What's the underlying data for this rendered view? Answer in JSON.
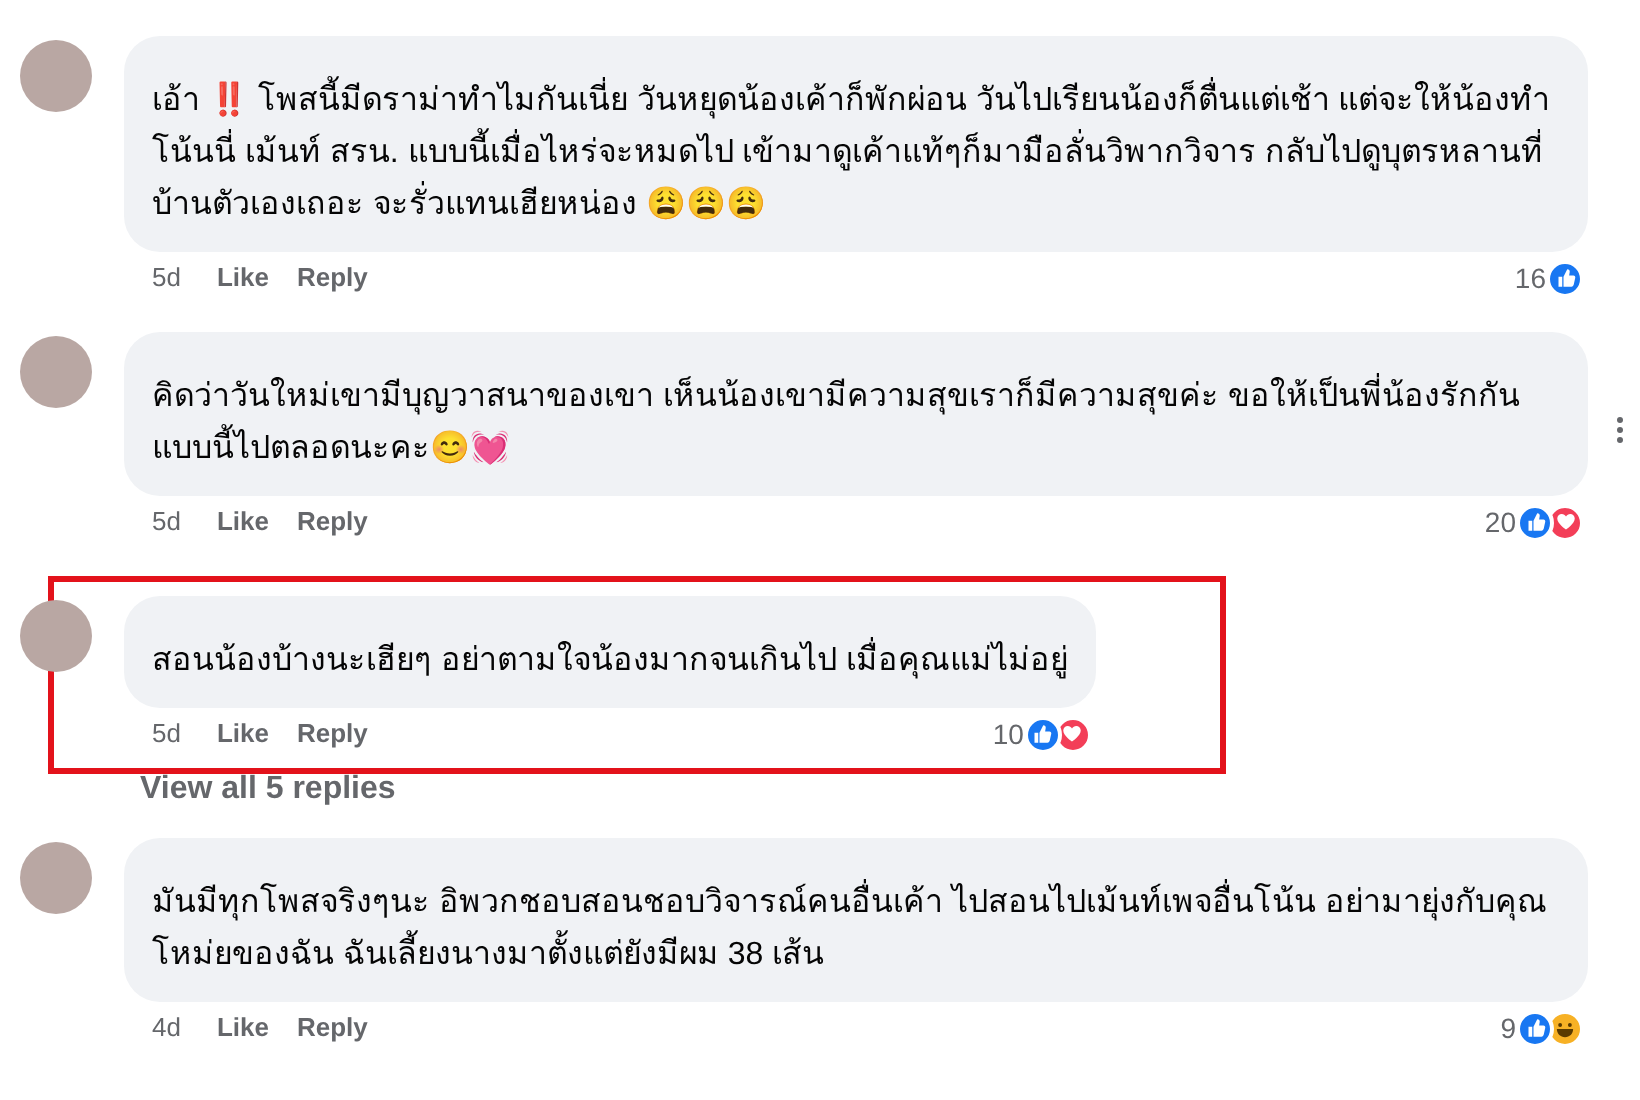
{
  "comments": [
    {
      "text": "เอ้า ‼️ โพสนี้มีดราม่าทำไมกันเนี่ย วันหยุดน้องเค้าก็พักผ่อน วันไปเรียนน้องก็ตื่นแต่เช้า แต่จะให้น้องทำโน้นนี่ เม้นท์ สรน. แบบนี้เมื่อไหร่จะหมดไป เข้ามาดูเค้าแท้ๆก็มามือลั่นวิพากวิจาร กลับไปดูบุตรหลานที่บ้านตัวเองเถอะ จะรั่วแทนเฮียหน่อง 😩😩😩",
      "time": "5d",
      "like": "Like",
      "reply": "Reply",
      "reaction_count": "16",
      "reactions": [
        {
          "kind": "like"
        }
      ],
      "highlighted": false,
      "more_menu": false
    },
    {
      "text": "คิดว่าวันใหม่เขามีบุญวาสนาของเขา เห็นน้องเขามีความสุขเราก็มีความสุขค่ะ ขอให้เป็นพี่น้องรักกันแบบนี้ไปตลอดนะคะ😊💓",
      "time": "5d",
      "like": "Like",
      "reply": "Reply",
      "reaction_count": "20",
      "reactions": [
        {
          "kind": "like"
        },
        {
          "kind": "love"
        }
      ],
      "highlighted": false,
      "more_menu": true
    },
    {
      "text": "สอนน้องบ้างนะเฮียๆ อย่าตามใจน้องมากจนเกินไป เมื่อคุณแม่ไม่อยู่",
      "time": "5d",
      "like": "Like",
      "reply": "Reply",
      "reaction_count": "10",
      "reactions": [
        {
          "kind": "like"
        },
        {
          "kind": "love"
        }
      ],
      "highlighted": true,
      "more_menu": false,
      "replies_link": "View all 5 replies"
    },
    {
      "text": "มันมีทุกโพสจริงๆนะ อิพวกชอบสอนชอบวิจารณ์คนอื่นเค้า ไปสอนไปเม้นท์เพจอื่นโน้น อย่ามายุ่งกับคุณโหม่ยของฉัน ฉันเลี้ยงนางมาตั้งแต่ยังมีผม 38 เส้น",
      "time": "4d",
      "like": "Like",
      "reply": "Reply",
      "reaction_count": "9",
      "reactions": [
        {
          "kind": "like"
        },
        {
          "kind": "haha"
        }
      ],
      "highlighted": false,
      "more_menu": false
    }
  ]
}
